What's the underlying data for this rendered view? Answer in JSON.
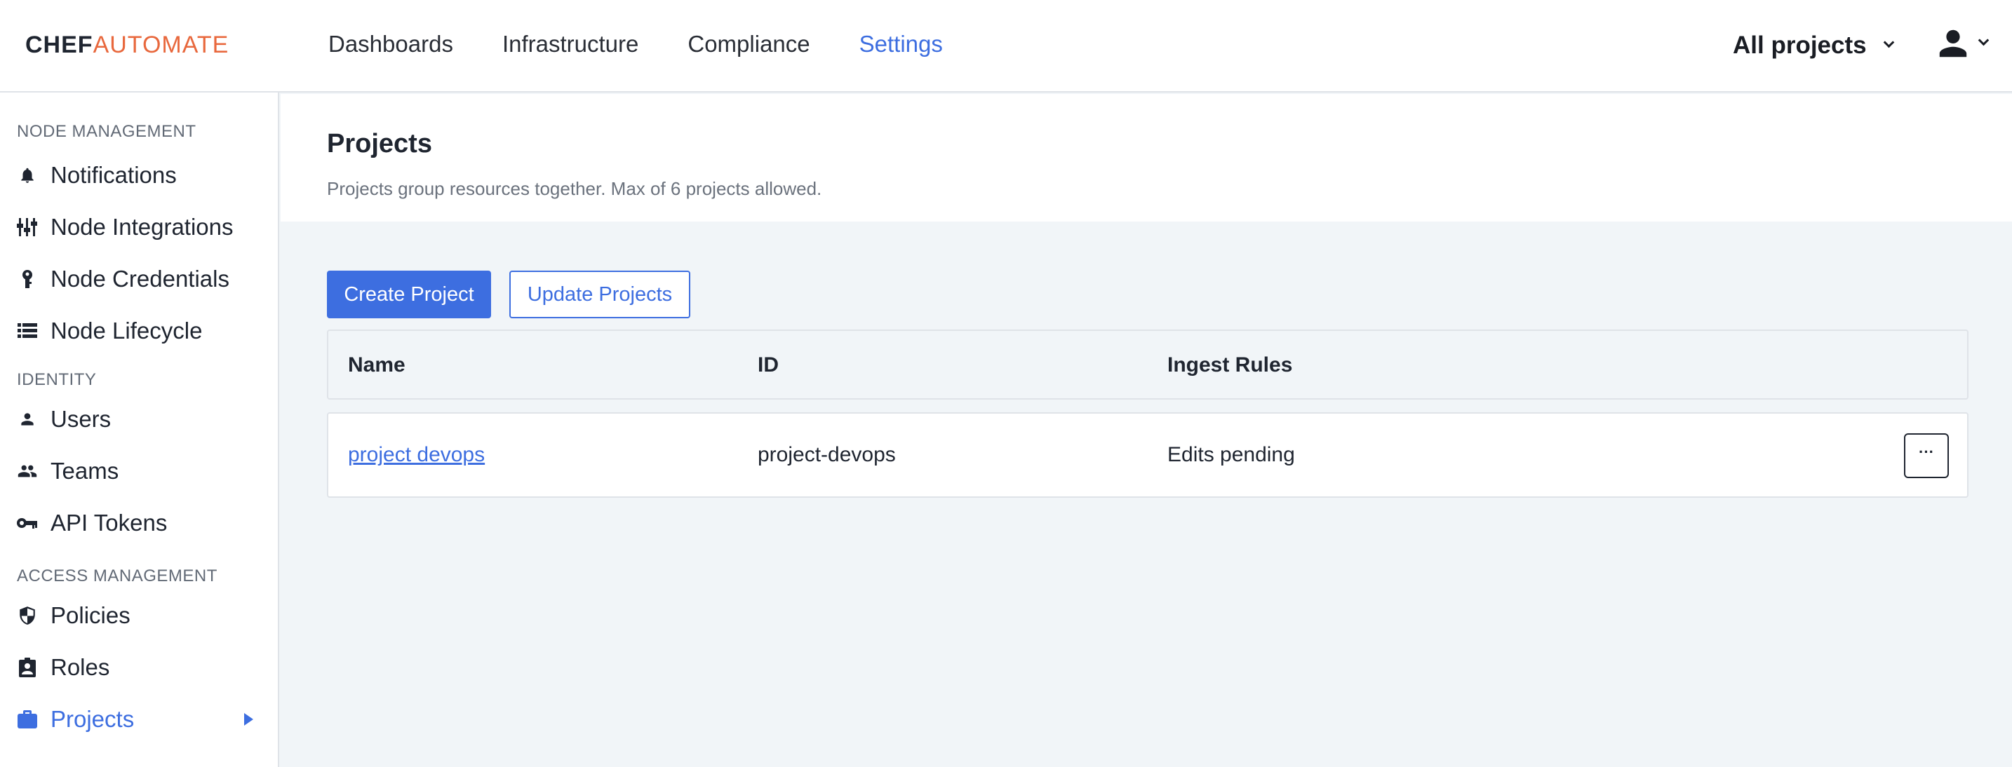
{
  "brand": {
    "part1": "CHEF",
    "part2": "AUTOMATE",
    "color": "#e8683d"
  },
  "nav": {
    "items": [
      {
        "label": "Dashboards"
      },
      {
        "label": "Infrastructure"
      },
      {
        "label": "Compliance"
      },
      {
        "label": "Settings",
        "active": true
      }
    ]
  },
  "project_filter": {
    "label": "All projects"
  },
  "sidebar": {
    "sections": [
      {
        "heading": "NODE MANAGEMENT",
        "items": [
          {
            "label": "Notifications",
            "icon": "bell-icon"
          },
          {
            "label": "Node Integrations",
            "icon": "sliders-icon"
          },
          {
            "label": "Node Credentials",
            "icon": "key-pin-icon"
          },
          {
            "label": "Node Lifecycle",
            "icon": "list-icon"
          }
        ]
      },
      {
        "heading": "IDENTITY",
        "items": [
          {
            "label": "Users",
            "icon": "person-icon"
          },
          {
            "label": "Teams",
            "icon": "people-icon"
          },
          {
            "label": "API Tokens",
            "icon": "vpn-key-icon"
          }
        ]
      },
      {
        "heading": "ACCESS MANAGEMENT",
        "items": [
          {
            "label": "Policies",
            "icon": "shield-icon"
          },
          {
            "label": "Roles",
            "icon": "badge-icon"
          },
          {
            "label": "Projects",
            "icon": "briefcase-icon",
            "active": true
          }
        ]
      }
    ]
  },
  "page": {
    "title": "Projects",
    "subtitle": "Projects group resources together. Max of 6 projects allowed."
  },
  "actions": {
    "create": "Create Project",
    "update": "Update Projects"
  },
  "table": {
    "columns": [
      "Name",
      "ID",
      "Ingest Rules"
    ],
    "rows": [
      {
        "name": "project devops",
        "id": "project-devops",
        "ingest_rules": "Edits pending",
        "menu": "···"
      }
    ]
  },
  "colors": {
    "accent": "#3d6ee0",
    "background": "#f1f5f8",
    "text": "#1f2530"
  }
}
